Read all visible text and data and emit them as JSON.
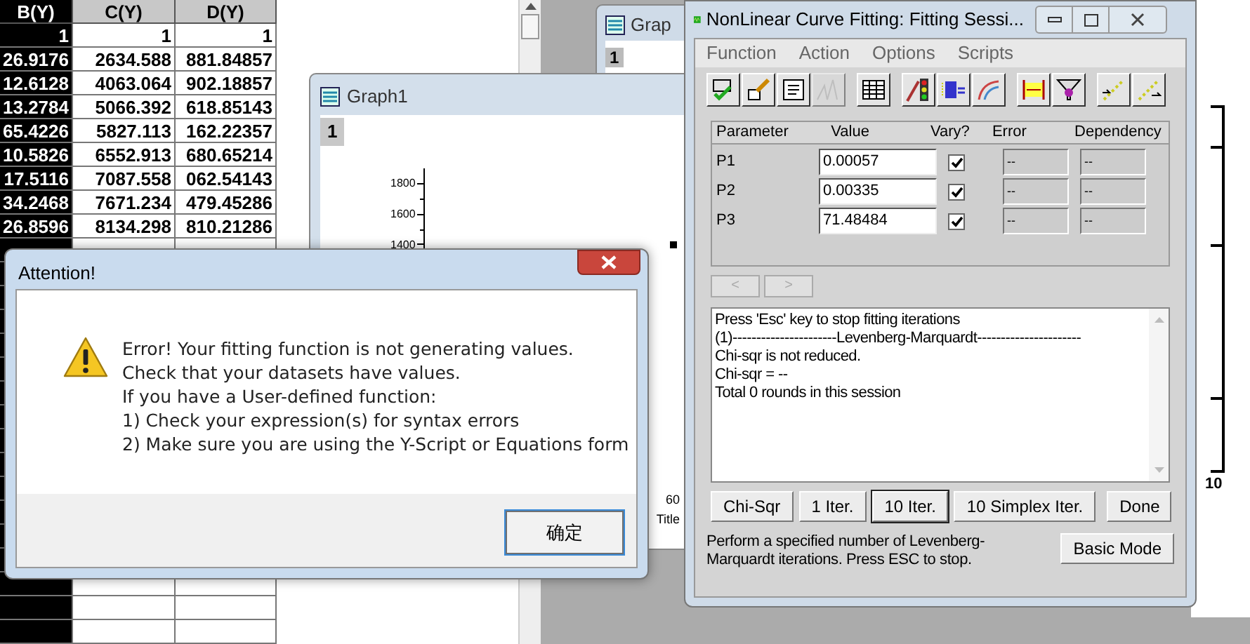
{
  "worksheet": {
    "columns": [
      {
        "label": "B(Y)",
        "selected": true
      },
      {
        "label": "C(Y)",
        "selected": false
      },
      {
        "label": "D(Y)",
        "selected": false
      }
    ],
    "rows": [
      [
        "1",
        "1",
        "1"
      ],
      [
        "26.9176",
        "2634.588",
        "881.84857"
      ],
      [
        "12.6128",
        "4063.064",
        "902.18857"
      ],
      [
        "13.2784",
        "5066.392",
        "618.85143"
      ],
      [
        "65.4226",
        "5827.113",
        "162.22357"
      ],
      [
        "10.5826",
        "6552.913",
        "680.65214"
      ],
      [
        "17.5116",
        "7087.558",
        "062.54143"
      ],
      [
        "34.2468",
        "7671.234",
        "479.45286"
      ],
      [
        "26.8596",
        "8134.298",
        "810.21286"
      ]
    ]
  },
  "graph_back": {
    "title": "Grap",
    "layer": "1"
  },
  "graph1": {
    "title": "Graph1",
    "layer": "1",
    "yticks": [
      "1800",
      "1600",
      "1400"
    ],
    "xtick": "60",
    "xlabel": "Title"
  },
  "right_graph": {
    "xtick": "10"
  },
  "nlfit": {
    "title": "NonLinear Curve Fitting:  Fitting Sessi...",
    "menu": [
      "Function",
      "Action",
      "Options",
      "Scripts"
    ],
    "toolbar": [
      [
        {
          "kind": "fx-check",
          "disabled": false
        },
        {
          "kind": "fx-edit",
          "disabled": false
        },
        {
          "kind": "fx-file",
          "disabled": false
        },
        {
          "kind": "peaks",
          "disabled": true
        }
      ],
      [
        {
          "kind": "table",
          "disabled": false
        }
      ],
      [
        {
          "kind": "traffic",
          "disabled": false
        },
        {
          "kind": "param",
          "disabled": false
        },
        {
          "kind": "curve",
          "disabled": false
        }
      ],
      [
        {
          "kind": "range",
          "disabled": false
        },
        {
          "kind": "filter",
          "disabled": false
        }
      ],
      [
        {
          "kind": "dots-in",
          "disabled": false
        },
        {
          "kind": "dots-out",
          "disabled": false
        }
      ]
    ],
    "columns": [
      "Parameter",
      "Value",
      "Vary?",
      "Error",
      "Dependency"
    ],
    "params": [
      {
        "name": "P1",
        "value": "0.00057",
        "vary": true,
        "error": "--",
        "dependency": "--"
      },
      {
        "name": "P2",
        "value": "0.00335",
        "vary": true,
        "error": "--",
        "dependency": "--"
      },
      {
        "name": "P3",
        "value": "71.48484",
        "vary": true,
        "error": "--",
        "dependency": "--"
      }
    ],
    "nav": [
      {
        "label": "<",
        "disabled": true
      },
      {
        "label": ">",
        "disabled": true
      }
    ],
    "log": [
      "Press 'Esc' key to stop fitting iterations",
      "(1)----------------------Levenberg-Marquardt----------------------",
      "Chi-sqr is not reduced.",
      "Chi-sqr = --",
      "Total 0 rounds in this session"
    ],
    "buttons": [
      {
        "label": "Chi-Sqr",
        "selected": false
      },
      {
        "label": "1 Iter.",
        "selected": false
      },
      {
        "label": "10 Iter.",
        "selected": true
      },
      {
        "label": "10 Simplex Iter.",
        "selected": false
      }
    ],
    "done": "Done",
    "hint": "Perform a specified number of Levenberg-Marquardt iterations. Press ESC to stop.",
    "mode_button": "Basic Mode"
  },
  "dialog": {
    "title": "Attention!",
    "lines": [
      "Error! Your fitting function is not generating values.",
      "Check that your datasets have values.",
      "If you have a User-defined function:",
      "1) Check your expression(s) for syntax errors",
      "2) Make sure you are using the Y-Script or Equations form"
    ],
    "ok": "确定"
  }
}
